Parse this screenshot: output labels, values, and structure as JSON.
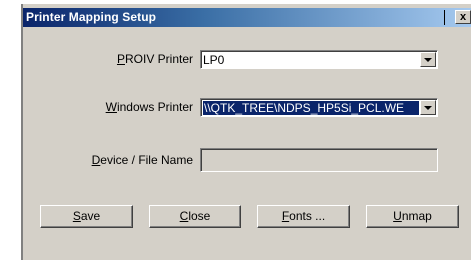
{
  "window": {
    "title": "Printer Mapping Setup",
    "close_glyph": "x"
  },
  "form": {
    "proiv_printer": {
      "label_accel": "P",
      "label_rest": "ROIV Printer",
      "value": "LP0"
    },
    "windows_printer": {
      "label_accel": "W",
      "label_rest": "indows Printer",
      "value": "\\\\QTK_TREE\\NDPS_HP5Si_PCL.WE"
    },
    "device_file_name": {
      "label_accel": "D",
      "label_rest": "evice / File Name",
      "value": ""
    }
  },
  "buttons": [
    {
      "accel": "S",
      "rest": "ave"
    },
    {
      "accel": "C",
      "rest": "lose"
    },
    {
      "accel": "F",
      "rest": "onts ..."
    },
    {
      "accel": "U",
      "rest": "nmap"
    }
  ],
  "colors": {
    "titlebar_start": "#0a246a",
    "titlebar_end": "#a6caf0",
    "dialog_face": "#d4d0c8",
    "selection": "#0a246a"
  }
}
